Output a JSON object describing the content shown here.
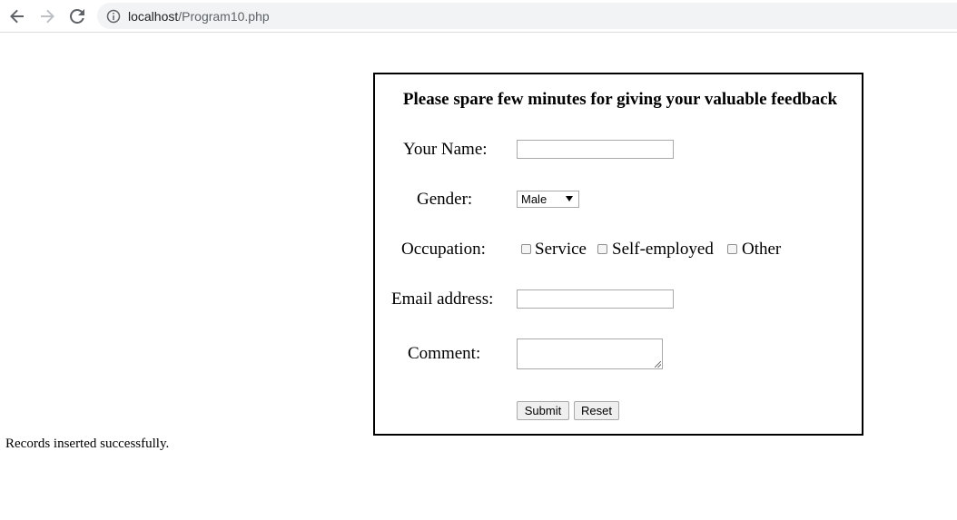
{
  "browser": {
    "url_host": "localhost",
    "url_path": "/Program10.php",
    "icons": [
      "back-arrow-icon",
      "forward-arrow-icon",
      "reload-icon",
      "info-icon"
    ]
  },
  "form": {
    "heading": "Please spare few minutes for giving your valuable feedback",
    "name_label": "Your Name:",
    "name_value": "",
    "gender_label": "Gender:",
    "gender_selected": "Male",
    "occupation_label": "Occupation:",
    "occupations": [
      "Service",
      "Self-employed",
      "Other"
    ],
    "email_label": "Email address:",
    "email_value": "",
    "comment_label": "Comment:",
    "comment_value": "",
    "submit_label": "Submit",
    "reset_label": "Reset"
  },
  "status": {
    "message": "Records inserted successfully."
  }
}
